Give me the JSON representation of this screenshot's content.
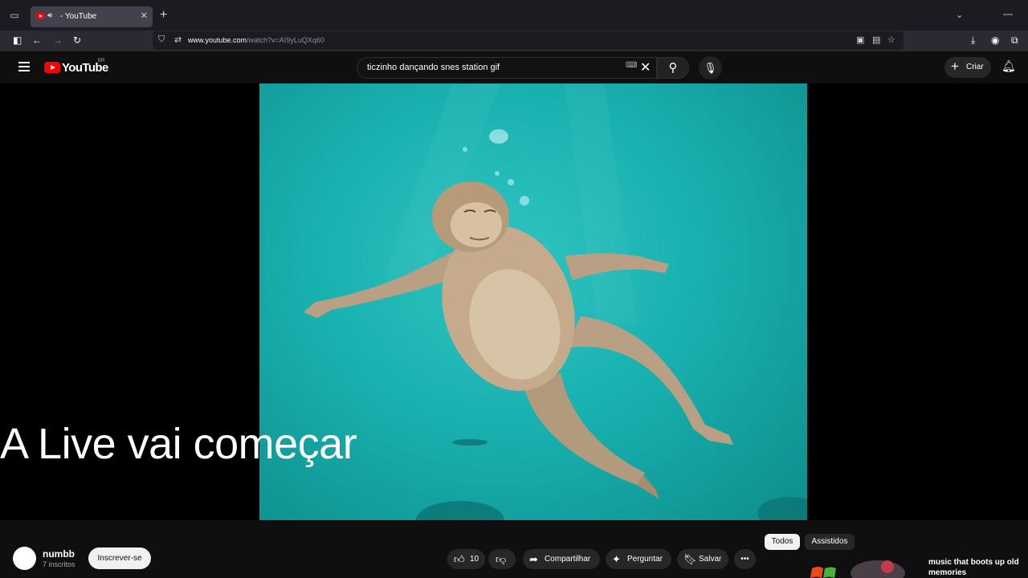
{
  "browser": {
    "tab_title": "- YouTube",
    "url_domain": "www.youtube.com",
    "url_path": "/watch?v=AI9yLuQXq60"
  },
  "youtube": {
    "logo_text": "YouTube",
    "country_code": "BR",
    "search_query": "ticzinho dançando snes station gif",
    "create_label": "Criar"
  },
  "video": {
    "overlay_text": "A Live vai começar"
  },
  "channel": {
    "name": "numbb",
    "subscribers": "7 inscritos",
    "subscribe_label": "Inscrever-se"
  },
  "actions": {
    "like_count": "10",
    "share_label": "Compartilhar",
    "ask_label": "Perguntar",
    "save_label": "Salvar"
  },
  "filters": {
    "all_label": "Todos",
    "watched_label": "Assistidos"
  },
  "recommendation": {
    "title": "music that boots up old memories"
  },
  "colors": {
    "brand_red": "#ff0000",
    "video_water": "#1fb5b3"
  },
  "icons": [
    "tab-list-icon",
    "youtube-favicon",
    "speaker-icon",
    "close-icon",
    "plus-icon",
    "chevron-down-icon",
    "minimize-icon",
    "sidebar-icon",
    "back-icon",
    "forward-icon",
    "reload-icon",
    "shield-icon",
    "permissions-icon",
    "picture-in-picture-icon",
    "reader-icon",
    "star-icon",
    "download-icon",
    "account-icon",
    "extensions-icon",
    "hamburger-icon",
    "keyboard-icon",
    "search-icon",
    "mic-icon",
    "bell-icon",
    "like-icon",
    "dislike-icon",
    "share-icon",
    "sparkle-icon",
    "bookmark-icon",
    "more-icon"
  ]
}
